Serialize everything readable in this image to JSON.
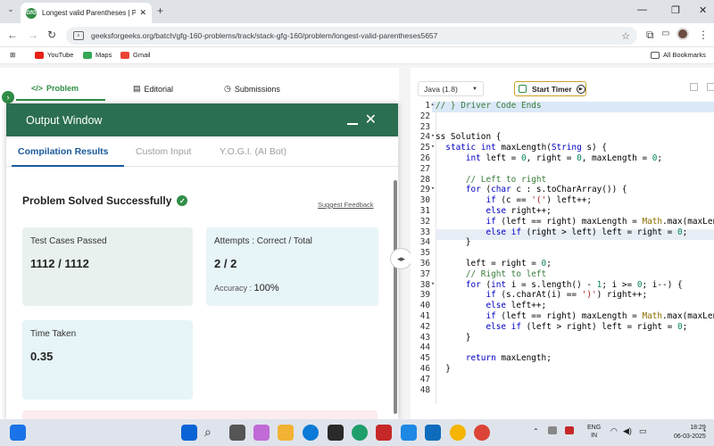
{
  "browser": {
    "tab_title": "Longest valid Parentheses | Pra",
    "url": "geeksforgeeks.org/batch/gfg-160-problems/track/stack-gfg-160/problem/longest-valid-parentheses5657",
    "bookmarks": [
      {
        "label": "YouTube"
      },
      {
        "label": "Maps"
      },
      {
        "label": "Gmail"
      }
    ],
    "all_bookmarks": "All Bookmarks"
  },
  "nav": {
    "tabs": [
      "Problem",
      "Editorial",
      "Submissions"
    ]
  },
  "output_window": {
    "title": "Output Window",
    "tabs": [
      "Compilation Results",
      "Custom Input",
      "Y.O.G.I. (AI Bot)"
    ],
    "status": "Problem Solved Successfully",
    "suggest_feedback": "Suggest Feedback",
    "tests_label": "Test Cases Passed",
    "tests_value": "1112 / 1112",
    "attempts_label": "Attempts : Correct / Total",
    "attempts_value": "2 / 2",
    "accuracy_label": "Accuracy :",
    "accuracy_value": "100%",
    "time_label": "Time Taken",
    "time_value": "0.35"
  },
  "editor": {
    "language": "Java (1.8)",
    "timer_label": "Start Timer",
    "lines": [
      {
        "n": "1",
        "fold": "▸",
        "text": "// } Driver Code Ends"
      },
      {
        "n": "22",
        "fold": "",
        "text": ""
      },
      {
        "n": "23",
        "fold": "",
        "text": ""
      },
      {
        "n": "24",
        "fold": "▾",
        "text": "ss Solution {"
      },
      {
        "n": "25",
        "fold": "▾",
        "text": "  static int maxLength(String s) {"
      },
      {
        "n": "26",
        "fold": "",
        "text": "      int left = 0, right = 0, maxLength = 0;"
      },
      {
        "n": "27",
        "fold": "",
        "text": ""
      },
      {
        "n": "28",
        "fold": "",
        "text": "      // Left to right"
      },
      {
        "n": "29",
        "fold": "▾",
        "text": "      for (char c : s.toCharArray()) {"
      },
      {
        "n": "30",
        "fold": "",
        "text": "          if (c == '(') left++;"
      },
      {
        "n": "31",
        "fold": "",
        "text": "          else right++;"
      },
      {
        "n": "32",
        "fold": "",
        "text": "          if (left == right) maxLength = Math.max(maxLen"
      },
      {
        "n": "33",
        "fold": "",
        "text": "          else if (right > left) left = right = 0;"
      },
      {
        "n": "34",
        "fold": "",
        "text": "      }"
      },
      {
        "n": "35",
        "fold": "",
        "text": ""
      },
      {
        "n": "36",
        "fold": "",
        "text": "      left = right = 0;"
      },
      {
        "n": "37",
        "fold": "",
        "text": "      // Right to left"
      },
      {
        "n": "38",
        "fold": "▾",
        "text": "      for (int i = s.length() - 1; i >= 0; i--) {"
      },
      {
        "n": "39",
        "fold": "",
        "text": "          if (s.charAt(i) == ')') right++;"
      },
      {
        "n": "40",
        "fold": "",
        "text": "          else left++;"
      },
      {
        "n": "41",
        "fold": "",
        "text": "          if (left == right) maxLength = Math.max(maxLen"
      },
      {
        "n": "42",
        "fold": "",
        "text": "          else if (left > right) left = right = 0;"
      },
      {
        "n": "43",
        "fold": "",
        "text": "      }"
      },
      {
        "n": "44",
        "fold": "",
        "text": ""
      },
      {
        "n": "45",
        "fold": "",
        "text": "      return maxLength;"
      },
      {
        "n": "46",
        "fold": "",
        "text": "  }"
      },
      {
        "n": "47",
        "fold": "",
        "text": ""
      },
      {
        "n": "48",
        "fold": "",
        "text": ""
      }
    ]
  },
  "taskbar": {
    "lang": "ENG",
    "lang2": "IN",
    "time": "18:29",
    "date": "06-03-2025"
  },
  "colors": {
    "brand_green": "#2f8d46",
    "header_green": "#2b6e52",
    "tab_blue": "#1a5a9c"
  }
}
